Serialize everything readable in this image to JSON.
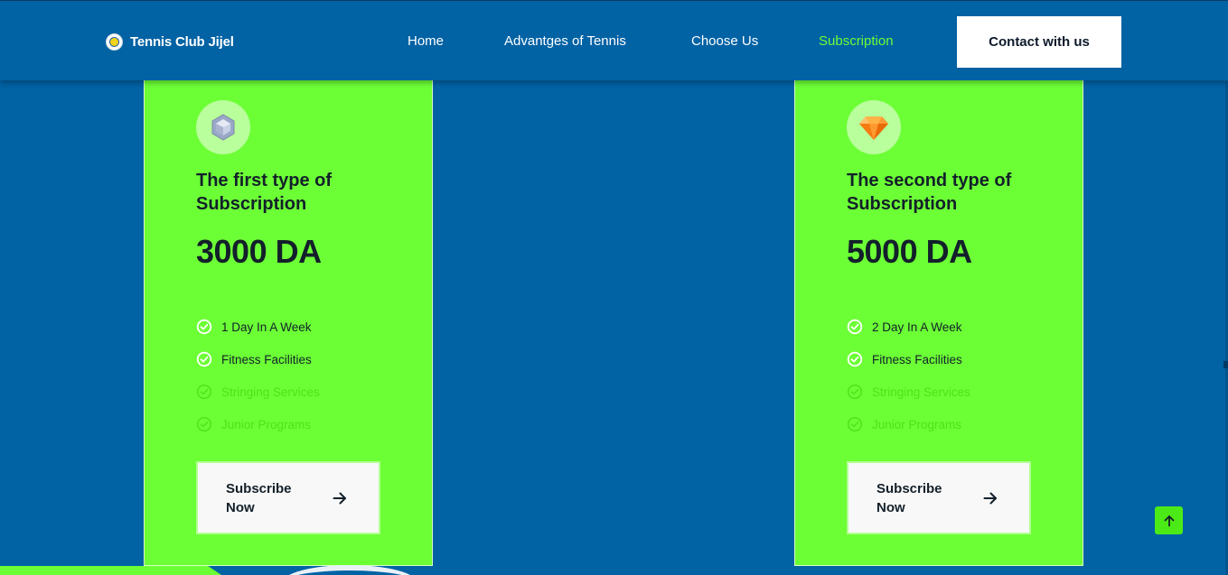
{
  "header": {
    "brand": "Tennis Club Jijel",
    "nav": [
      {
        "label": "Home",
        "active": false
      },
      {
        "label": "Advantges of Tennis",
        "active": false
      },
      {
        "label": "Choose Us",
        "active": false
      },
      {
        "label": "Subscription",
        "active": true
      }
    ],
    "contact_label": "Contact with us"
  },
  "plans": [
    {
      "title": "The first type of Subscription",
      "price": "3000 DA",
      "icon": "silver-gem-icon",
      "features": [
        {
          "label": "1 Day In A Week",
          "included": true
        },
        {
          "label": "Fitness Facilities",
          "included": true
        },
        {
          "label": "Stringing Services",
          "included": false
        },
        {
          "label": "Junior Programs",
          "included": false
        }
      ],
      "cta": "Subscribe Now"
    },
    {
      "title": "The second type of Subscription",
      "price": "5000 DA",
      "icon": "orange-diamond-icon",
      "features": [
        {
          "label": "2 Day In A Week",
          "included": true
        },
        {
          "label": "Fitness Facilities",
          "included": true
        },
        {
          "label": "Stringing Services",
          "included": false
        },
        {
          "label": "Junior Programs",
          "included": false
        }
      ],
      "cta": "Subscribe Now"
    }
  ],
  "colors": {
    "background": "#0162a4",
    "accent_green": "#6cff35",
    "active_nav": "#6cff35",
    "text_dark": "#13202a"
  }
}
